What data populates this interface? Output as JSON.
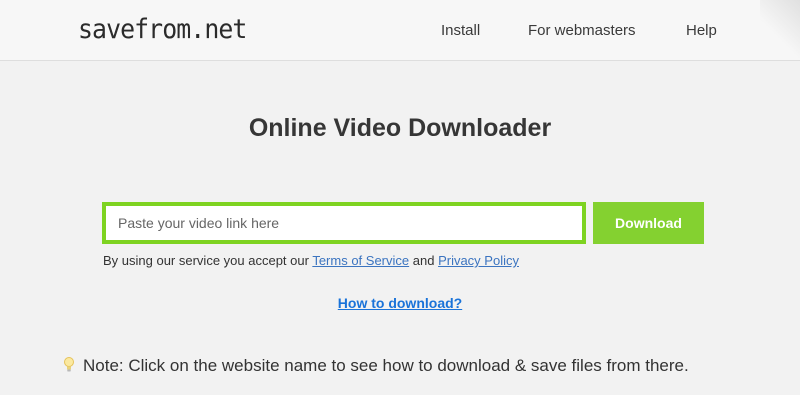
{
  "header": {
    "logo": "savefrom.net",
    "nav": [
      "Install",
      "For webmasters",
      "Help"
    ]
  },
  "main": {
    "title": "Online Video Downloader",
    "input_placeholder": "Paste your video link here",
    "download_label": "Download",
    "terms_prefix": "By using our service you accept our ",
    "terms_link": "Terms of Service",
    "terms_and": " and ",
    "privacy_link": "Privacy Policy",
    "howto_link": "How to download?",
    "note_text": "Note: Click on the website name to see how to download & save files from there."
  },
  "colors": {
    "accent_green": "#7ed321",
    "link_blue": "#1a73d9"
  },
  "icons": {
    "note_icon": "lightbulb-icon"
  }
}
